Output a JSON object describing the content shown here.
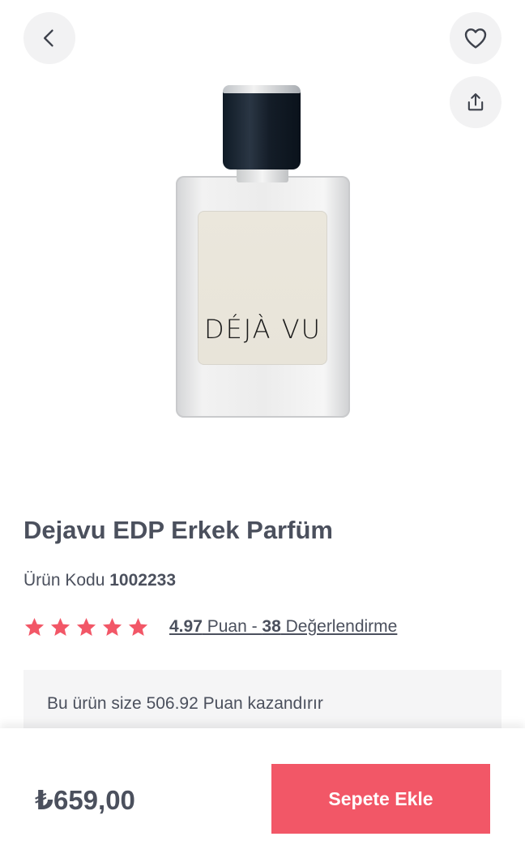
{
  "header": {
    "back_icon": "chevron-left-icon",
    "favorite_icon": "heart-icon",
    "share_icon": "share-icon"
  },
  "product": {
    "image_brand_text": "DÉJÀ VU",
    "title": "Dejavu EDP Erkek Parfüm",
    "code_label": "Ürün Kodu",
    "code_value": "1002233"
  },
  "rating": {
    "stars": 5,
    "star_color": "#f25767",
    "score": "4.97",
    "score_suffix": " Puan - ",
    "count": "38",
    "count_suffix": " Değerlendirme"
  },
  "points": {
    "text": "Bu ürün size 506.92 Puan kazandırır"
  },
  "cart": {
    "price": "₺659,00",
    "add_label": "Sepete Ekle",
    "accent_color": "#f25767"
  }
}
